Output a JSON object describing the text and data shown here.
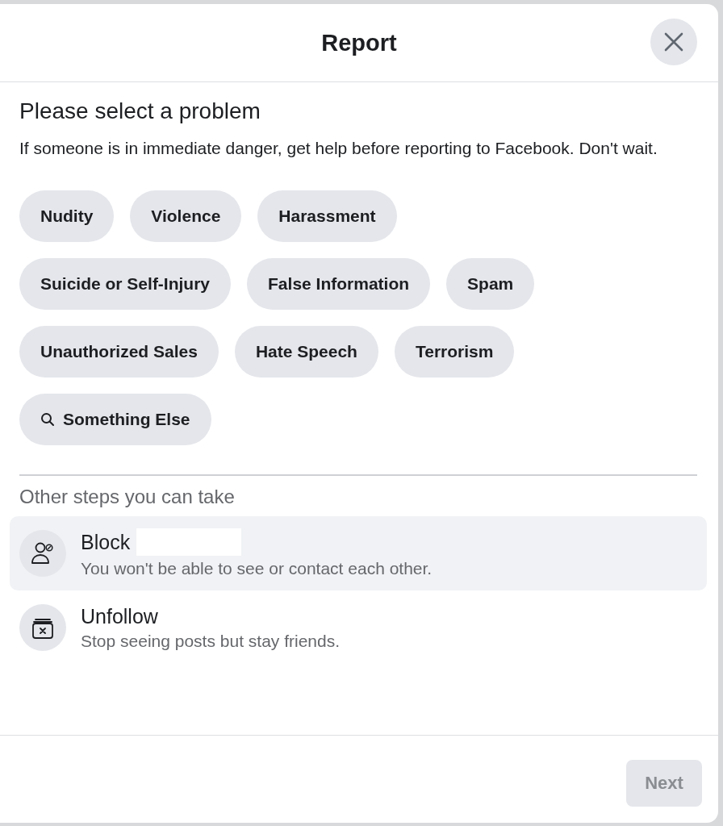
{
  "dialog": {
    "title": "Report",
    "heading": "Please select a problem",
    "notice": "If someone is in immediate danger, get help before reporting to Facebook. Don't wait."
  },
  "problems": [
    {
      "label": "Nudity",
      "kind": "plain",
      "selected": false
    },
    {
      "label": "Violence",
      "kind": "plain",
      "selected": false
    },
    {
      "label": "Harassment",
      "kind": "plain",
      "selected": false
    },
    {
      "label": "Suicide or Self-Injury",
      "kind": "plain",
      "selected": false
    },
    {
      "label": "False Information",
      "kind": "plain",
      "selected": false
    },
    {
      "label": "Spam",
      "kind": "plain",
      "selected": false
    },
    {
      "label": "Unauthorized Sales",
      "kind": "plain",
      "selected": false
    },
    {
      "label": "Hate Speech",
      "kind": "plain",
      "selected": false
    },
    {
      "label": "Terrorism",
      "kind": "plain",
      "selected": false
    },
    {
      "label": "Something Else",
      "kind": "search",
      "selected": false
    }
  ],
  "other_steps": {
    "heading": "Other steps you can take",
    "items": [
      {
        "title": "Block",
        "description": "You won't be able to see or contact each other.",
        "kind": "block",
        "highlighted": true,
        "redacted": true
      },
      {
        "title": "Unfollow",
        "description": "Stop seeing posts but stay friends.",
        "kind": "unfollow",
        "highlighted": false,
        "redacted": false
      }
    ]
  },
  "footer": {
    "next": {
      "label": "Next",
      "disabled": true
    }
  }
}
